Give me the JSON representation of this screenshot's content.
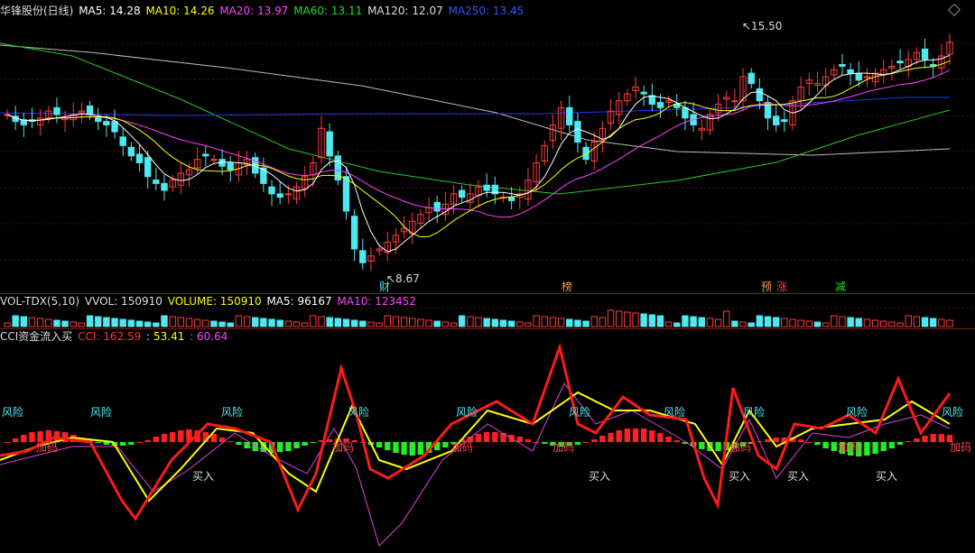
{
  "colors": {
    "bg": "#000000",
    "up": "#ff3b3b",
    "down": "#4ee8f0",
    "ma5": "#ffffff",
    "ma10": "#ffff00",
    "ma20": "#ff40ff",
    "ma60": "#22cc22",
    "ma120": "#bbbbbb",
    "ma250": "#2233ff",
    "cci": "#ff1a1a",
    "cci_ma1": "#ffff00",
    "cci_ma2": "#e040e0"
  },
  "price_legend": {
    "title": "华锋股份(日线)",
    "ma5": "MA5: 14.28",
    "ma10": "MA10: 14.26",
    "ma20": "MA20: 13.97",
    "ma60": "MA60: 13.11",
    "ma120": "MA120: 12.07",
    "ma250": "MA250: 13.45"
  },
  "vol_legend": {
    "title": "VOL-TDX(5,10)",
    "vvol": "VVOL: 150910",
    "volume": "VOLUME: 150910",
    "ma5": "MA5: 96167",
    "ma10": "MA10: 123452"
  },
  "cci_legend": {
    "title": "CCI资金流入买",
    "cci": "CCI: 162.59",
    "v2": ": 53.41",
    "v3": ": 60.64"
  },
  "price_annotations": {
    "high": "15.50",
    "low": "8.67"
  },
  "event_markers": [
    "财",
    "榜",
    "预",
    "涨",
    "减"
  ],
  "signal_labels": {
    "risk": "风险",
    "add": "加码",
    "buy": "买入"
  },
  "chart_data": {
    "type": "candlestick",
    "title": "华锋股份(日线)",
    "closes": [
      13.2,
      13.0,
      12.9,
      13.0,
      13.1,
      13.3,
      13.2,
      13.1,
      13.2,
      13.3,
      13.2,
      13.0,
      12.9,
      12.7,
      12.3,
      12.0,
      11.8,
      11.4,
      11.2,
      11.0,
      11.3,
      11.5,
      11.6,
      11.9,
      12.0,
      11.9,
      11.7,
      11.6,
      11.8,
      11.9,
      11.5,
      11.2,
      10.9,
      10.8,
      10.9,
      11.1,
      11.4,
      11.8,
      12.8,
      12.0,
      11.3,
      10.4,
      9.3,
      8.9,
      9.1,
      9.3,
      9.5,
      9.7,
      9.9,
      10.1,
      10.3,
      10.5,
      10.4,
      10.6,
      10.9,
      10.8,
      10.9,
      11.1,
      11.0,
      10.9,
      10.8,
      10.7,
      10.9,
      11.3,
      11.8,
      12.3,
      12.9,
      13.4,
      12.9,
      12.4,
      11.9,
      12.4,
      12.8,
      13.3,
      13.6,
      13.8,
      14.0,
      13.8,
      13.5,
      13.4,
      13.6,
      13.4,
      13.1,
      12.9,
      12.8,
      13.2,
      13.5,
      13.7,
      13.6,
      14.3,
      14.1,
      13.6,
      13.1,
      12.9,
      13.0,
      13.6,
      14.0,
      14.2,
      14.1,
      14.3,
      14.5,
      14.6,
      14.4,
      14.2,
      14.3,
      14.4,
      14.5,
      14.6,
      14.7,
      14.8,
      15.0,
      14.8,
      14.6,
      14.9,
      15.3
    ],
    "ma_values": {
      "MA5": 14.28,
      "MA10": 14.26,
      "MA20": 13.97,
      "MA60": 13.11,
      "MA120": 12.07,
      "MA250": 13.45
    },
    "volume": {
      "VVOL": 150910,
      "VOLUME": 150910,
      "MA5": 96167,
      "MA10": 123452
    },
    "cci": {
      "CCI": 162.59,
      "MA1": 53.41,
      "MA2": 60.64
    }
  }
}
